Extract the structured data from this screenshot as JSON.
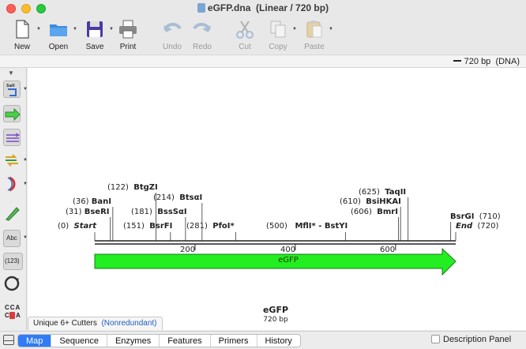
{
  "window": {
    "filename": "eGFP.dna",
    "subtitle": "(Linear / 720 bp)"
  },
  "toolbar": {
    "new": "New",
    "open": "Open",
    "save": "Save",
    "print": "Print",
    "undo": "Undo",
    "redo": "Redo",
    "cut": "Cut",
    "copy": "Copy",
    "paste": "Paste"
  },
  "status": {
    "length": "720 bp",
    "type": "(DNA)"
  },
  "left_tools": {
    "abc_label": "Abc",
    "num_label": "(123)",
    "cca_top": "CCA",
    "cca_bottom_left": "C",
    "cca_bottom_right": "A"
  },
  "map": {
    "total_bp": 720,
    "ticks": [
      {
        "pos": 200,
        "label": "200"
      },
      {
        "pos": 400,
        "label": "400"
      },
      {
        "pos": 600,
        "label": "600"
      }
    ],
    "sites": [
      {
        "id": "start",
        "pos": "(0)",
        "name": "Start",
        "style": "italic"
      },
      {
        "id": "bseri",
        "pos": "(31)",
        "name": "BseRI",
        "style": "bold"
      },
      {
        "id": "bani",
        "pos": "(36)",
        "name": "BanI",
        "style": "bold"
      },
      {
        "id": "btgzi",
        "pos": "(122)",
        "name": "BtgZI",
        "style": "bold"
      },
      {
        "id": "bsrfi",
        "pos": "(151)",
        "name": "BsrFI",
        "style": "bold"
      },
      {
        "id": "bsssai",
        "pos": "(181)",
        "name": "BssSαI",
        "style": "bold"
      },
      {
        "id": "btsai",
        "pos": "(214)",
        "name": "BtsαI",
        "style": "bold"
      },
      {
        "id": "pfoi",
        "pos": "(281)",
        "name": "PfoI*",
        "style": "bold"
      },
      {
        "id": "mfli",
        "pos": "(500)",
        "name": "MflI* - BstYI",
        "style": "bold"
      },
      {
        "id": "bmri",
        "pos": "(606)",
        "name": "BmrI",
        "style": "bold"
      },
      {
        "id": "bsihkai",
        "pos": "(610)",
        "name": "BsiHKAI",
        "style": "bold"
      },
      {
        "id": "taqii",
        "pos": "(625)",
        "name": "TaqII",
        "style": "bold"
      },
      {
        "id": "bsrgi",
        "pos": "(710)",
        "name": "BsrGI",
        "style": "bold"
      },
      {
        "id": "end",
        "pos": "(720)",
        "name": "End",
        "style": "italic"
      }
    ],
    "feature": {
      "name": "eGFP",
      "color": "#22ee22"
    },
    "sequence_name": "eGFP",
    "sequence_length": "720 bp"
  },
  "cutters": {
    "label": "Unique 6+ Cutters",
    "mode": "(Nonredundant)"
  },
  "tabs": [
    "Map",
    "Sequence",
    "Enzymes",
    "Features",
    "Primers",
    "History"
  ],
  "active_tab": "Map",
  "description_panel": "Description Panel"
}
